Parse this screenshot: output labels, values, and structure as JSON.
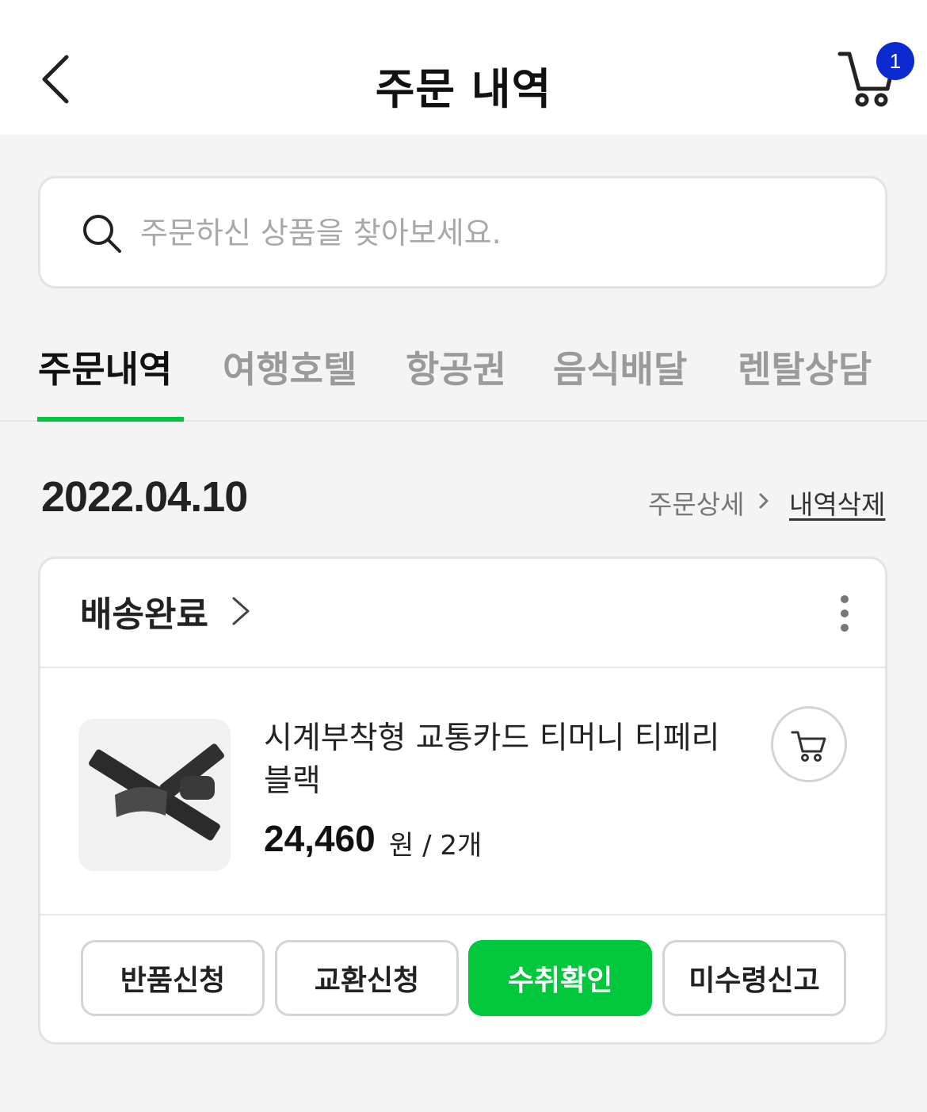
{
  "header": {
    "title": "주문 내역",
    "cart_count": "1"
  },
  "search": {
    "placeholder": "주문하신 상품을 찾아보세요."
  },
  "tabs": [
    {
      "label": "주문내역",
      "active": true
    },
    {
      "label": "여행호텔",
      "active": false
    },
    {
      "label": "항공권",
      "active": false
    },
    {
      "label": "음식배달",
      "active": false
    },
    {
      "label": "렌탈상담",
      "active": false
    }
  ],
  "order": {
    "date": "2022.04.10",
    "detail_link": "주문상세",
    "delete_link": "내역삭제",
    "status": "배송완료",
    "product": {
      "name": "시계부착형 교통카드 티머니 티페리 블랙",
      "price": "24,460",
      "price_unit": "원 / 2개"
    },
    "actions": [
      "반품신청",
      "교환신청",
      "수취확인",
      "미수령신고"
    ]
  },
  "colors": {
    "accent_green": "#00c73c",
    "badge_blue": "#0b2bd1"
  },
  "icons": [
    "back-arrow-icon",
    "cart-icon",
    "search-icon",
    "chevron-right-icon",
    "more-vertical-icon",
    "add-to-cart-icon"
  ]
}
